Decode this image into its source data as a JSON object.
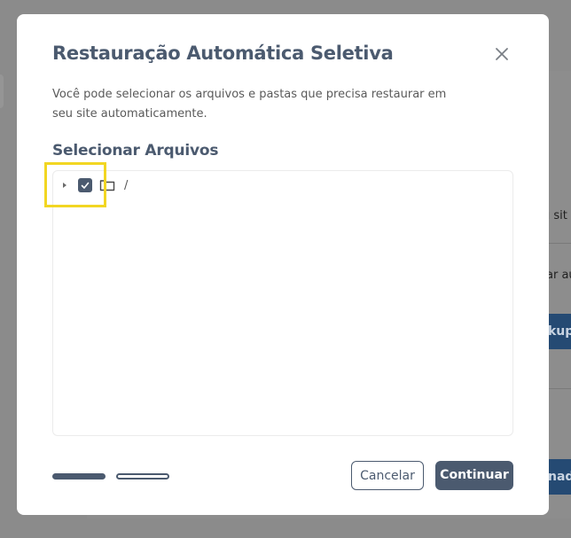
{
  "background": {
    "fragments": [
      "u sit",
      "ar au",
      "kup",
      "nado"
    ]
  },
  "modal": {
    "title": "Restauração Automática Seletiva",
    "description": "Você pode selecionar os arquivos e pastas que precisa restaurar em seu site automaticamente.",
    "section_title": "Selecionar Arquivos",
    "tree": {
      "root_label": "/",
      "checked": true,
      "expanded": false
    },
    "steps": {
      "current": 1,
      "total": 2
    },
    "buttons": {
      "cancel": "Cancelar",
      "continue": "Continuar"
    }
  },
  "colors": {
    "primary": "#4b5a6f",
    "highlight": "#f2d622",
    "overlay": "#8a8a8a",
    "bg_button": "#254a73"
  },
  "icons": {
    "close": "close-icon",
    "caret": "caret-right-icon",
    "checkbox": "check-icon",
    "folder": "folder-icon"
  }
}
